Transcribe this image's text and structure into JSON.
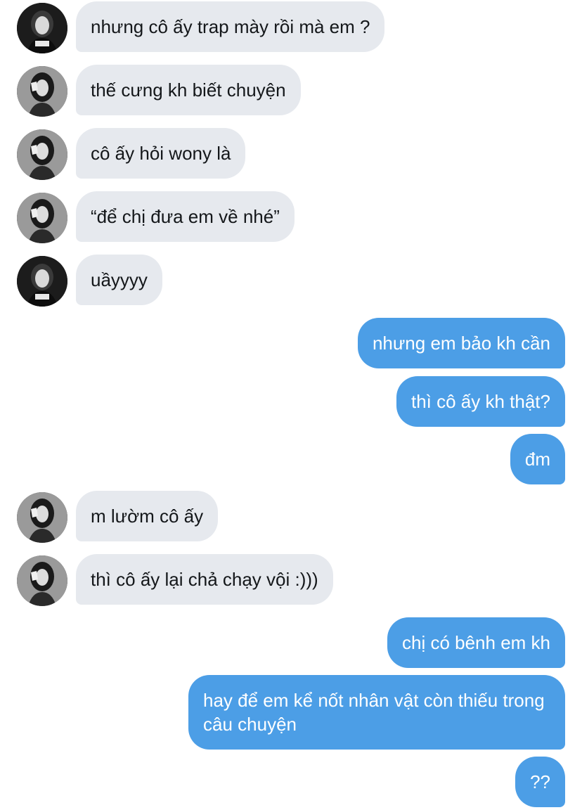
{
  "messages": [
    {
      "side": "in",
      "avatar": "avatar-dark",
      "text": "nhưng cô ấy trap mày rồi mà em ?"
    },
    {
      "side": "in",
      "avatar": "avatar-light",
      "text": "thế cưng kh biết chuyện"
    },
    {
      "side": "in",
      "avatar": "avatar-light",
      "text": "cô ấy hỏi wony là"
    },
    {
      "side": "in",
      "avatar": "avatar-light",
      "text": "“để chị đưa em về nhé”"
    },
    {
      "side": "in",
      "avatar": "avatar-dark",
      "text": "uầyyyy"
    },
    {
      "side": "out",
      "text": "nhưng em bảo kh cần"
    },
    {
      "side": "out",
      "text": "thì cô ấy kh thật?"
    },
    {
      "side": "out",
      "text": "đm"
    },
    {
      "side": "in",
      "avatar": "avatar-light",
      "text": "m lườm cô ấy"
    },
    {
      "side": "in",
      "avatar": "avatar-light",
      "text": "thì cô ấy lại chả chạy vội :)))"
    },
    {
      "side": "out",
      "text": "chị có bênh em kh"
    },
    {
      "side": "out",
      "text": "hay để em kể nốt nhân vật còn thiếu trong câu chuyện"
    },
    {
      "side": "out",
      "text": "??"
    }
  ],
  "colors": {
    "incoming_bubble": "#e6e9ee",
    "outgoing_bubble": "#4c9ee6",
    "incoming_text": "#14171a",
    "outgoing_text": "#ffffff"
  }
}
